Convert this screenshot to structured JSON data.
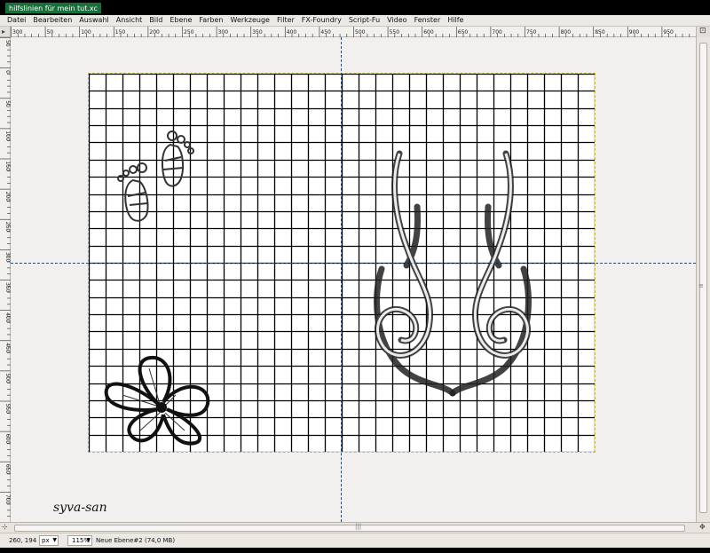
{
  "window": {
    "title": "hilfslinien für mein tut.xc"
  },
  "menu": {
    "items": [
      "Datei",
      "Bearbeiten",
      "Auswahl",
      "Ansicht",
      "Bild",
      "Ebene",
      "Farben",
      "Werkzeuge",
      "Filter",
      "FX-Foundry",
      "Script-Fu",
      "Video",
      "Fenster",
      "Hilfe"
    ]
  },
  "ruler": {
    "horizontal_labels": [
      "300",
      "50",
      "100",
      "150",
      "200",
      "250",
      "300",
      "350",
      "400",
      "450",
      "500",
      "550",
      "600",
      "650",
      "700",
      "750",
      "800",
      "850",
      "900",
      "950"
    ],
    "vertical_labels": [
      "50",
      "0",
      "50",
      "100",
      "150",
      "200",
      "250",
      "300",
      "350",
      "400",
      "450",
      "500",
      "550",
      "600",
      "650",
      "700"
    ]
  },
  "canvas": {
    "signature_text": "syva-san",
    "background_color": "#f1f0ee",
    "image_color": "#ffffff",
    "guide_color": "#2b4a6b",
    "grid_color": "#000000",
    "grid_columns": 30,
    "grid_rows": 22
  },
  "status": {
    "coordinates": "260, 194",
    "unit": "px",
    "zoom": "115%",
    "layer_info": "Neue Ebene#2 (74,0 MB)"
  },
  "icons": {
    "corner": "quick-mask-arrow-icon",
    "zoom": "zoom-toggle-icon",
    "navigate": "navigate-icon"
  }
}
